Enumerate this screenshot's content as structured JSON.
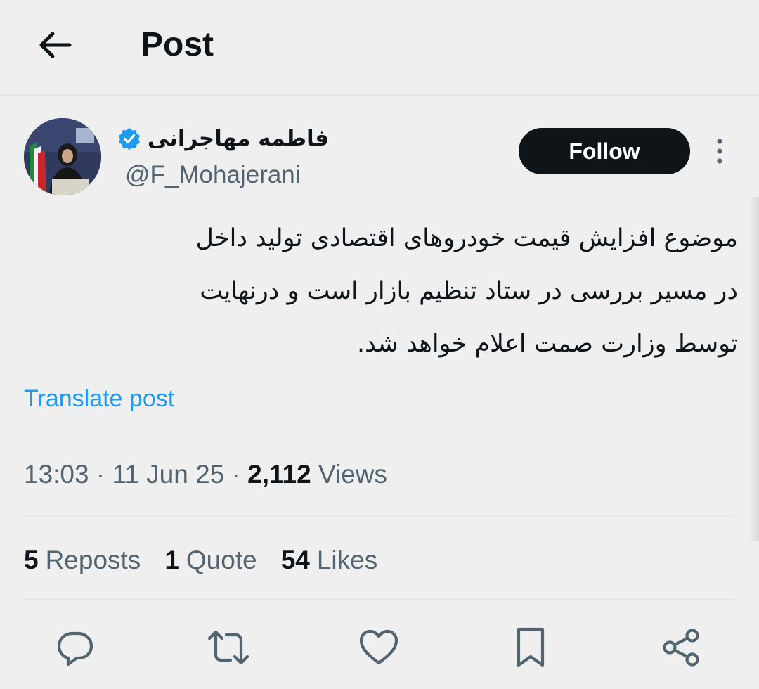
{
  "header": {
    "title": "Post",
    "back_icon": "arrow-left-icon"
  },
  "author": {
    "display_name": "فاطمه مهاجرانی",
    "handle": "@F_Mohajerani",
    "verified": true,
    "verified_color": "#1d9bf0"
  },
  "follow": {
    "label": "Follow"
  },
  "post": {
    "lines": [
      "موضوع افزایش قیمت خودروهای اقتصادی تولید داخل",
      "در مسیر بررسی در ستاد تنظیم بازار است و درنهایت",
      "توسط وزارت صمت اعلام خواهد شد."
    ],
    "translate_label": "Translate post",
    "time": "13:03",
    "separator": "·",
    "date": "11 Jun 25",
    "views_count": "2,112",
    "views_label": "Views"
  },
  "stats": {
    "reposts": {
      "count": "5",
      "label": "Reposts"
    },
    "quotes": {
      "count": "1",
      "label": "Quote"
    },
    "likes": {
      "count": "54",
      "label": "Likes"
    }
  },
  "actions": [
    "reply-icon",
    "repost-icon",
    "like-icon",
    "bookmark-icon",
    "share-icon"
  ],
  "colors": {
    "accent": "#1d9bf0",
    "text": "#0f1419",
    "muted": "#536471",
    "background": "#efefef"
  }
}
